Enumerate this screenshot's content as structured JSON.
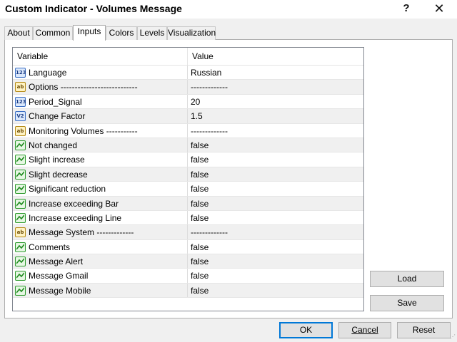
{
  "window": {
    "title": "Custom Indicator - Volumes Message",
    "help_label": "?",
    "close_label": "✕"
  },
  "tabs": [
    {
      "label": "About"
    },
    {
      "label": "Common"
    },
    {
      "label": "Inputs"
    },
    {
      "label": "Colors"
    },
    {
      "label": "Levels"
    },
    {
      "label": "Visualization"
    }
  ],
  "active_tab": "Inputs",
  "grid": {
    "header": {
      "variable": "Variable",
      "value": "Value"
    },
    "rows": [
      {
        "type": "int",
        "variable": "Language",
        "value": "Russian"
      },
      {
        "type": "str",
        "variable": "Options ---------------------------",
        "value": "-------------"
      },
      {
        "type": "int",
        "variable": "Period_Signal",
        "value": "20"
      },
      {
        "type": "dbl",
        "variable": "Change Factor",
        "value": "1.5"
      },
      {
        "type": "str",
        "variable": "Monitoring Volumes -----------",
        "value": "-------------"
      },
      {
        "type": "bool",
        "variable": "Not changed",
        "value": "false"
      },
      {
        "type": "bool",
        "variable": "Slight increase",
        "value": "false"
      },
      {
        "type": "bool",
        "variable": "Slight decrease",
        "value": "false"
      },
      {
        "type": "bool",
        "variable": "Significant reduction",
        "value": "false"
      },
      {
        "type": "bool",
        "variable": "Increase exceeding Bar",
        "value": "false"
      },
      {
        "type": "bool",
        "variable": "Increase exceeding Line",
        "value": "false"
      },
      {
        "type": "str",
        "variable": "Message System -------------",
        "value": "-------------"
      },
      {
        "type": "bool",
        "variable": "Comments",
        "value": "false"
      },
      {
        "type": "bool",
        "variable": "Message Alert",
        "value": "false"
      },
      {
        "type": "bool",
        "variable": "Message Gmail",
        "value": "false"
      },
      {
        "type": "bool",
        "variable": "Message Mobile",
        "value": "false"
      }
    ]
  },
  "buttons": {
    "load": "Load",
    "save": "Save",
    "ok": "OK",
    "cancel": "Cancel",
    "reset": "Reset"
  },
  "icons": {
    "int": "123",
    "dbl": "V2",
    "str": "ab"
  },
  "colors": {
    "accent": "#0078d7",
    "alt_row": "#f0f0f0",
    "dialog_bg": "#f0f0f0"
  }
}
